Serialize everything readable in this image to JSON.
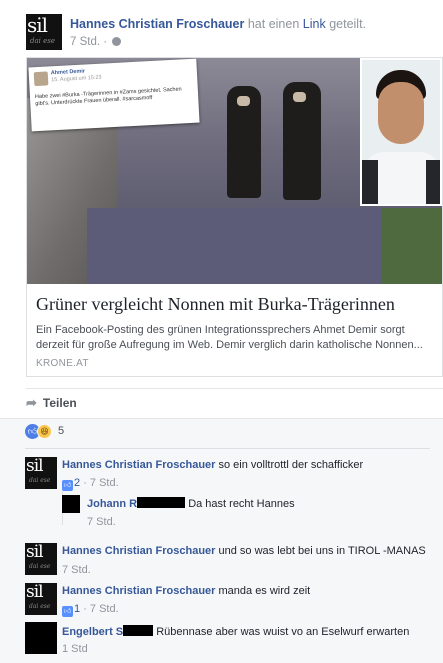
{
  "post": {
    "author": "Hannes Christian Froschauer",
    "action_prefix": "hat einen",
    "action_link": "Link",
    "action_suffix": "geteilt.",
    "time": "7 Std.",
    "avatar": {
      "big": "sil",
      "small": "dai ese"
    }
  },
  "link": {
    "title": "Grüner vergleicht Nonnen mit Burka-Trägerinnen",
    "description": "Ein Facebook-Posting des grünen Integrationssprechers Ahmet Demir sorgt derzeit für große Aufregung im Web. Demir verglich darin katholische Nonnen...",
    "domain": "KRONE.AT",
    "embedded_post": {
      "name": "Ahmet Demir",
      "time": "15. August um 15:23",
      "text": "Habe zwei #Burka -Trägerinnen in #Zams gesichtet. Sachen gibt's. Unterdrückte Frauen überall. #sarcasmoff"
    }
  },
  "share_label": "Teilen",
  "reactions": {
    "count": "5"
  },
  "comments": [
    {
      "author": "Hannes Christian Froschauer",
      "text": "so ein volltrottl der schafficker",
      "likes": "2",
      "time": "7 Std."
    },
    {
      "author": "Johann R",
      "text": "Da hast recht Hannes",
      "time": "7 Std.",
      "reply": true
    },
    {
      "author": "Hannes Christian Froschauer",
      "text": "und so was lebt bei uns in TIROL -MANAS",
      "time": "7 Std."
    },
    {
      "author": "Hannes Christian Froschauer",
      "text": "manda es wird zeit",
      "likes": "1",
      "time": "7 Std."
    },
    {
      "author": "Engelbert S",
      "text": "Rübennase aber was wuist vo an Eselwurf erwarten",
      "time": "1 Std"
    }
  ],
  "colors": {
    "link": "#365899",
    "muted": "#90949c",
    "like": "#5890ff"
  }
}
